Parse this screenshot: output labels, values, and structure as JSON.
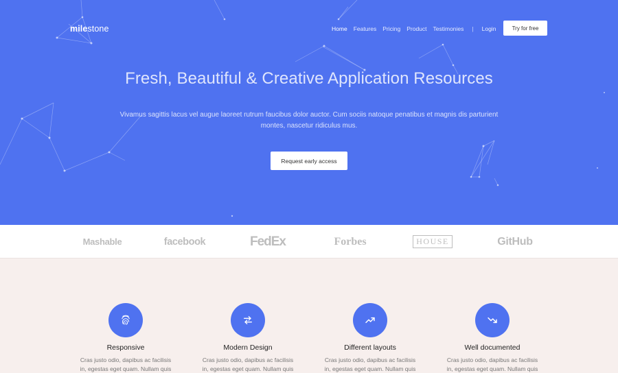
{
  "nav": {
    "logo_bold": "mile",
    "logo_thin": "stone",
    "links": [
      "Home",
      "Features",
      "Pricing",
      "Product",
      "Testimonies"
    ],
    "separator": "|",
    "login": "Login",
    "try_button": "Try for free"
  },
  "hero": {
    "title": "Fresh, Beautiful & Creative Application Resources",
    "text": "Vivamus sagittis lacus vel augue laoreet rutrum faucibus dolor auctor. Cum sociis natoque penatibus et magnis dis parturient montes, nascetur ridiculus mus.",
    "cta": "Request early access",
    "background_color": "#4f72f0"
  },
  "brands": [
    "Mashable",
    "facebook",
    "FedEx",
    "Forbes",
    "HOUSE",
    "GitHub"
  ],
  "features": [
    {
      "icon": "fingerprint-icon",
      "title": "Responsive",
      "text": "Cras justo odio, dapibus ac facilisis in, egestas eget quam. Nullam quis"
    },
    {
      "icon": "swap-arrows-icon",
      "title": "Modern Design",
      "text": "Cras justo odio, dapibus ac facilisis in, egestas eget quam. Nullam quis"
    },
    {
      "icon": "trending-up-icon",
      "title": "Different layouts",
      "text": "Cras justo odio, dapibus ac facilisis in, egestas eget quam. Nullam quis"
    },
    {
      "icon": "trending-down-icon",
      "title": "Well documented",
      "text": "Cras justo odio, dapibus ac facilisis in, egestas eget quam. Nullam quis"
    }
  ],
  "colors": {
    "accent": "#4f72f0",
    "features_background": "#f7efed",
    "brand_gray": "#bdbdbd"
  }
}
